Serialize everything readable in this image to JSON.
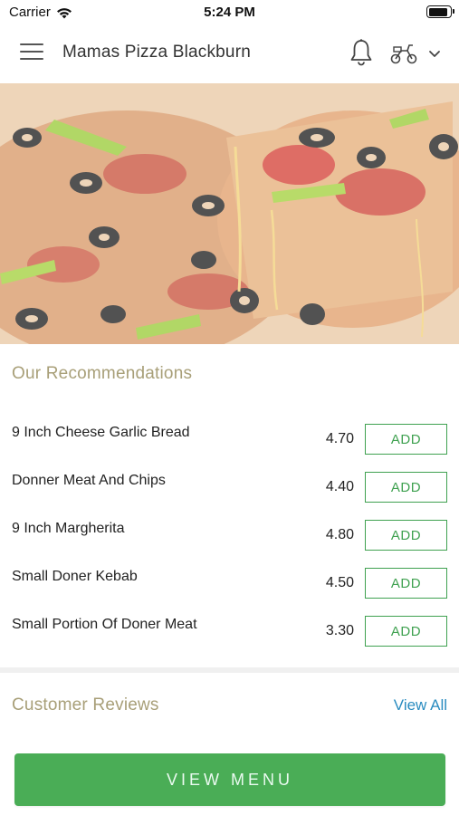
{
  "status_bar": {
    "carrier": "Carrier",
    "time": "5:24 PM",
    "battery_level": 0.92,
    "icons": [
      "wifi-icon",
      "battery-icon"
    ]
  },
  "app_bar": {
    "title": "Mamas Pizza Blackburn",
    "icons": [
      "hamburger-menu-icon",
      "bell-icon",
      "scooter-delivery-icon",
      "chevron-down-icon"
    ]
  },
  "hero": {
    "image": "pizza-photo"
  },
  "recommendations": {
    "title": "Our Recommendations",
    "add_label": "ADD",
    "items": [
      {
        "name": "9 Inch Cheese Garlic Bread",
        "price": "4.70"
      },
      {
        "name": "Donner Meat And Chips",
        "price": "4.40"
      },
      {
        "name": "9 Inch Margherita",
        "price": "4.80"
      },
      {
        "name": "Small Doner Kebab",
        "price": "4.50"
      },
      {
        "name": "Small Portion Of Doner Meat",
        "price": "3.30"
      }
    ]
  },
  "reviews": {
    "title": "Customer Reviews",
    "view_all_label": "View All"
  },
  "footer": {
    "view_menu_label": "VIEW MENU"
  },
  "colors": {
    "accent_green": "#4aad56",
    "section_title": "#a89f78",
    "link_blue": "#2a8cc0"
  }
}
